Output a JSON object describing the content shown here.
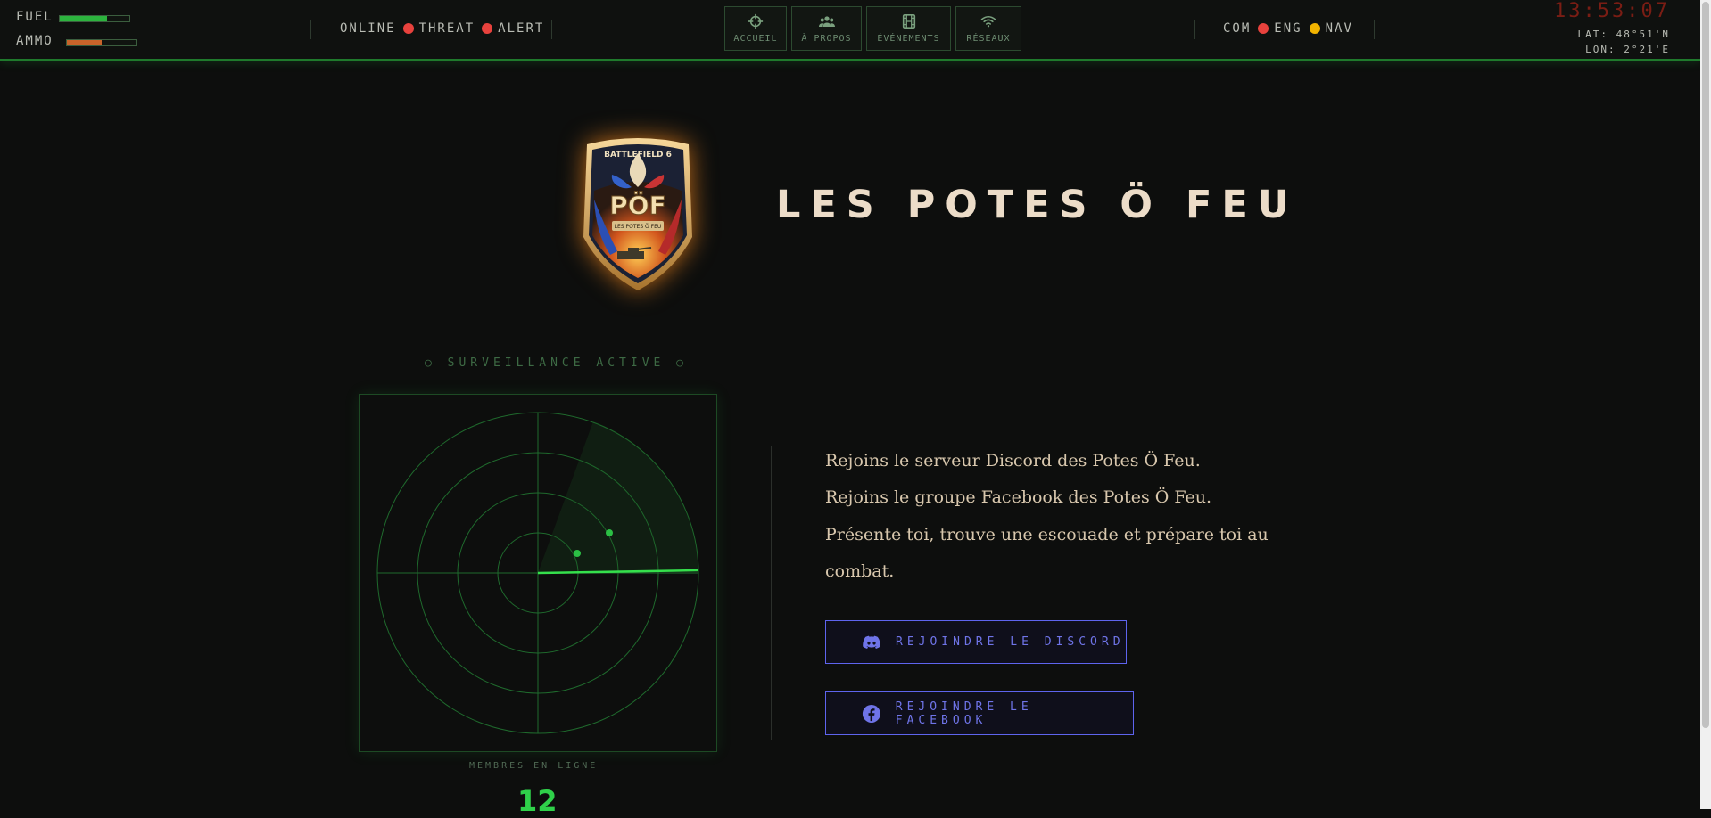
{
  "hud": {
    "fuel": {
      "label": "FUEL",
      "level_fraction": 0.68,
      "color": "#2cb43e"
    },
    "ammo": {
      "label": "AMMO",
      "level_fraction": 0.5,
      "color": "#c8632a"
    },
    "status_left": [
      {
        "label": "ONLINE"
      },
      {
        "label": "THREAT",
        "dot_color": "#e8423d"
      },
      {
        "label": "ALERT",
        "dot_color": "#e8423d"
      }
    ],
    "nav": [
      {
        "label": "ACCUEIL",
        "icon": "crosshair-icon"
      },
      {
        "label": "À PROPOS",
        "icon": "users-icon"
      },
      {
        "label": "ÉVÉNEMENTS",
        "icon": "film-icon"
      },
      {
        "label": "RÉSEAUX",
        "icon": "wifi-icon"
      }
    ],
    "status_right": [
      {
        "label": "COM",
        "dot_color": "#e8423d"
      },
      {
        "label": "ENG",
        "dot_color": "#f2b400"
      },
      {
        "label": "NAV"
      }
    ],
    "clock": "13:53:07",
    "lat": "LAT: 48°51'N",
    "lon": "LON: 2°21'E"
  },
  "hero": {
    "emblem": {
      "top_text": "BATTLEFIELD 6",
      "monogram": "PÖF",
      "ribbon": "LES POTES Ö FEU",
      "icon": "squad-crest-logo"
    },
    "title": "LES POTES Ö FEU"
  },
  "radar": {
    "caption": "○ SURVEILLANCE ACTIVE ○",
    "members_label": "MEMBRES EN LIGNE",
    "members_count": "12",
    "accent": "#2fd14a"
  },
  "intro": {
    "line1": "Rejoins le serveur Discord des Potes Ö Feu.",
    "line2": "Rejoins le groupe Facebook des Potes Ö Feu.",
    "line3": "Présente toi, trouve une escouade et prépare toi au combat."
  },
  "cta": {
    "discord_label": "REJOINDRE LE DISCORD",
    "discord_icon": "discord-icon",
    "facebook_label": "REJOINDRE LE FACEBOOK",
    "facebook_icon": "facebook-icon",
    "accent": "#5e64ee"
  }
}
